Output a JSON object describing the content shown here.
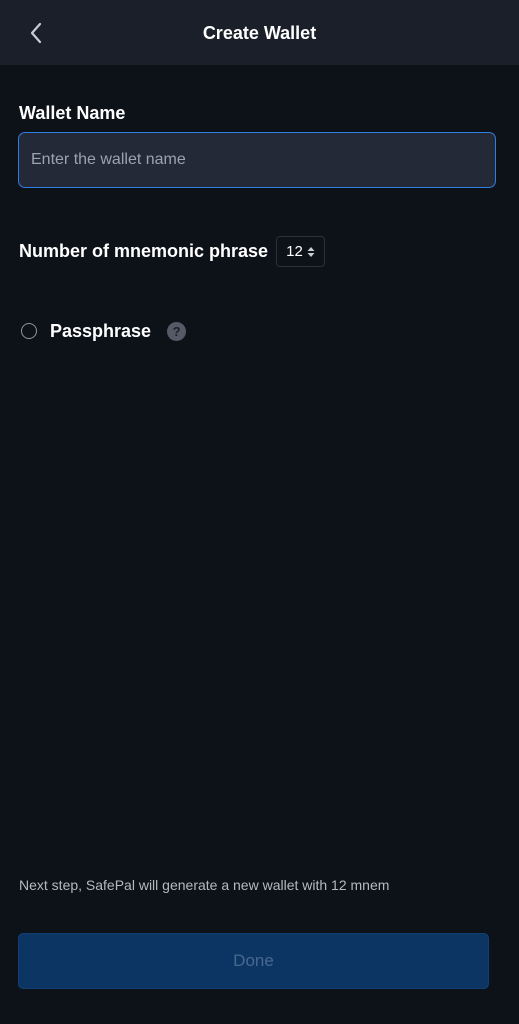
{
  "header": {
    "title": "Create Wallet",
    "back_icon": "chevron-left-icon"
  },
  "wallet_name": {
    "label": "Wallet Name",
    "placeholder": "Enter the wallet name",
    "value": ""
  },
  "mnemonic": {
    "label": "Number of mnemonic phrase",
    "selected": "12",
    "icon": "sort-arrows-icon"
  },
  "passphrase": {
    "label": "Passphrase",
    "checked": false,
    "help_symbol": "?"
  },
  "footer": {
    "note": "Next step, SafePal will generate a new wallet with 12 mnem",
    "done_label": "Done"
  },
  "colors": {
    "background": "#0d1118",
    "header": "#1b1f2a",
    "accent_border": "#2f7de0",
    "done_button": "#0c3564",
    "done_text": "#48698f"
  }
}
